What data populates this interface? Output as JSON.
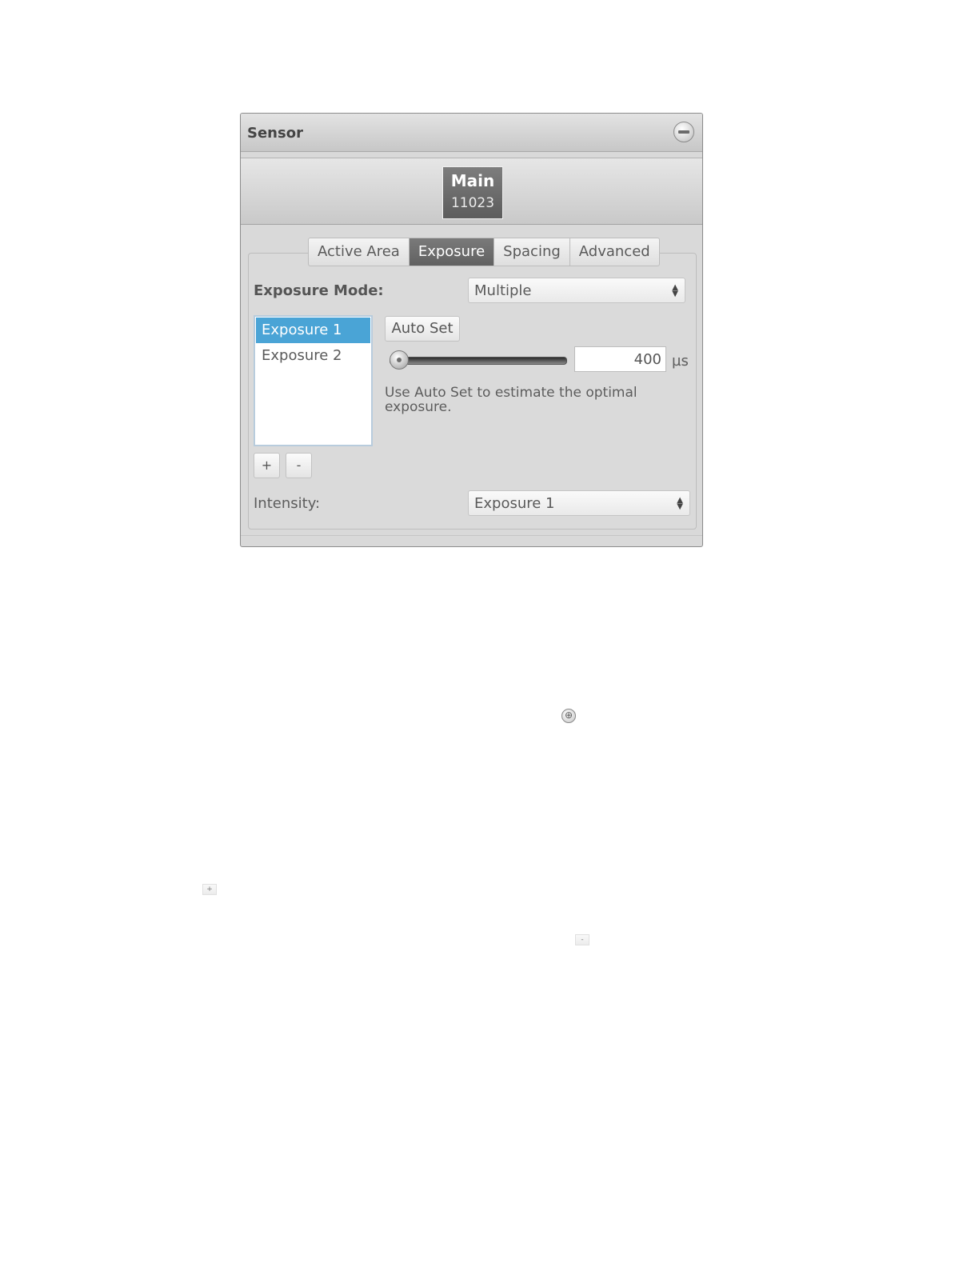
{
  "panel": {
    "title": "Sensor",
    "collapse_icon": "minus-circle-icon"
  },
  "sensor": {
    "name": "Main",
    "serial": "11023"
  },
  "tabs": [
    {
      "label": "Active Area",
      "active": false
    },
    {
      "label": "Exposure",
      "active": true
    },
    {
      "label": "Spacing",
      "active": false
    },
    {
      "label": "Advanced",
      "active": false
    }
  ],
  "exposure_mode": {
    "label": "Exposure Mode:",
    "value": "Multiple"
  },
  "exposure_list": {
    "items": [
      {
        "label": "Exposure 1",
        "selected": true
      },
      {
        "label": "Exposure 2",
        "selected": false
      }
    ],
    "add_label": "+",
    "remove_label": "-"
  },
  "auto_set": {
    "label": "Auto Set"
  },
  "exposure_value": {
    "value": "400",
    "unit": "µs",
    "slider_fraction": 0.03
  },
  "help_text": "Use Auto Set to estimate the optimal exposure.",
  "intensity": {
    "label": "Intensity:",
    "value": "Exposure 1"
  },
  "loose_icons": {
    "add_circle": "⊕",
    "plus": "+",
    "minus": "-"
  },
  "colors": {
    "selection": "#4aa4d6",
    "active_tab": "#6e6e6e",
    "panel_bg": "#d9d9d9"
  }
}
